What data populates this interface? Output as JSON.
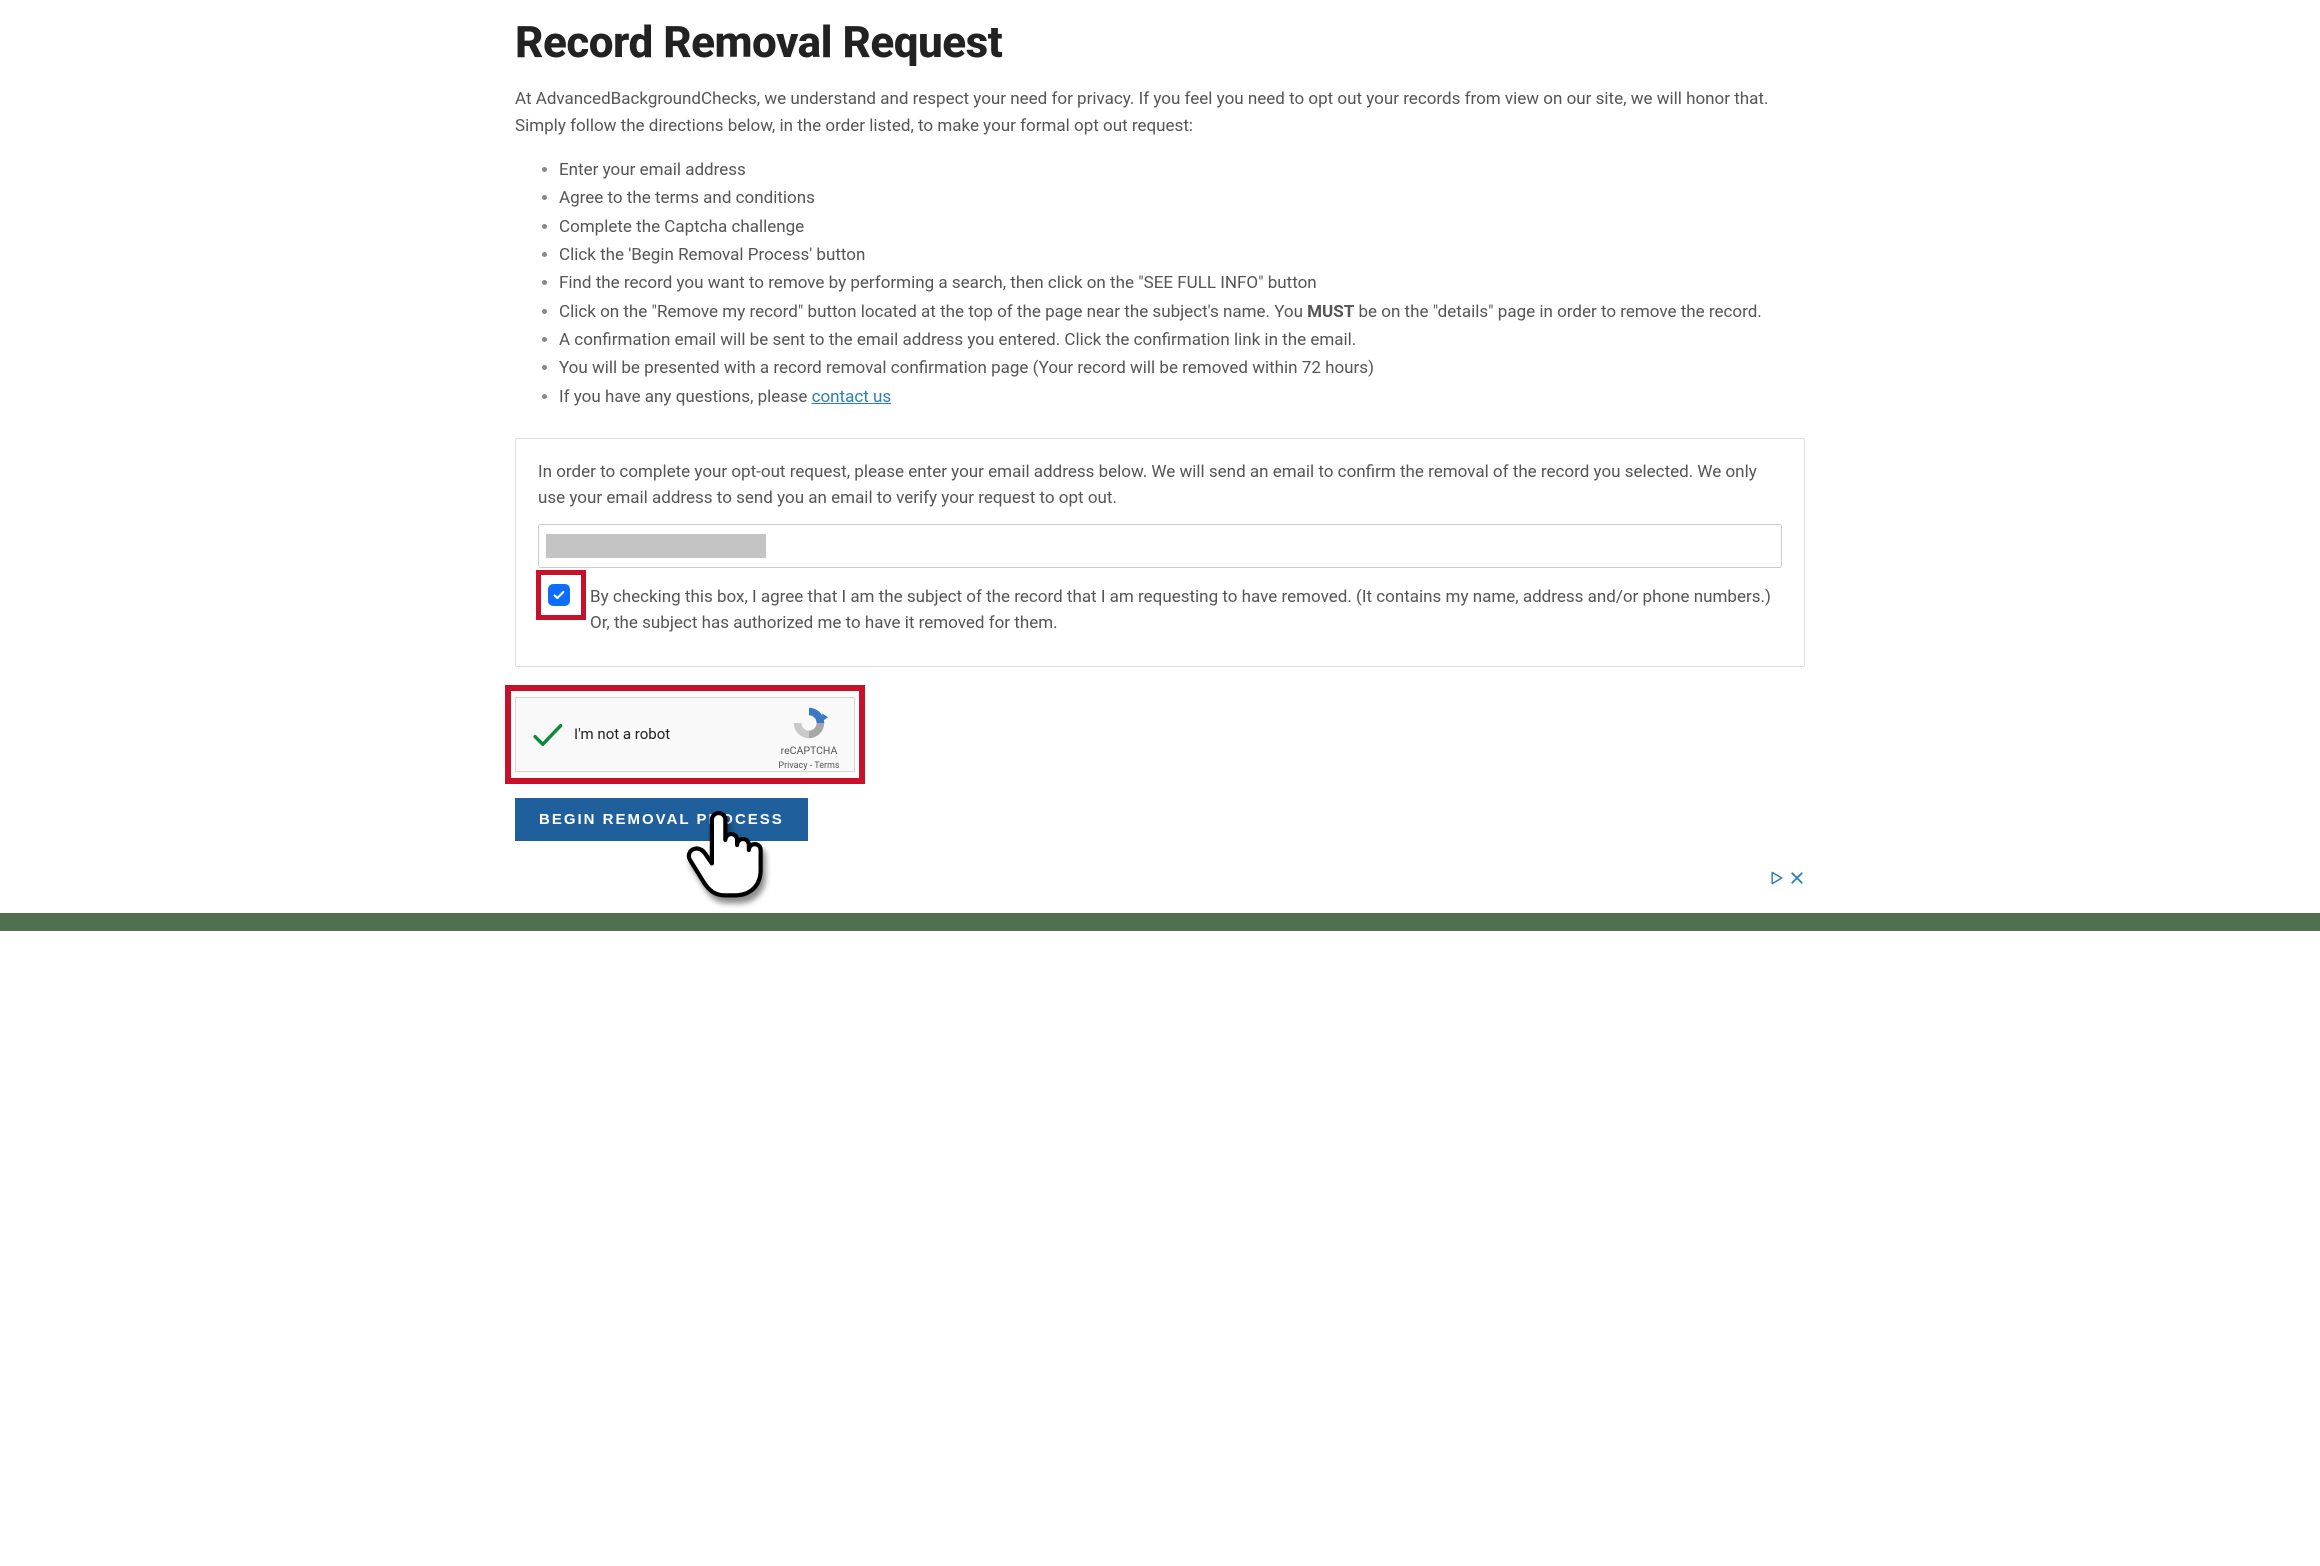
{
  "heading": "Record Removal Request",
  "intro": "At AdvancedBackgroundChecks, we understand and respect your need for privacy. If you feel you need to opt out your records from view on our site, we will honor that. Simply follow the directions below, in the order listed, to make your formal opt out request:",
  "steps": {
    "s1": "Enter your email address",
    "s2": "Agree to the terms and conditions",
    "s3": "Complete the Captcha challenge",
    "s4": "Click the 'Begin Removal Process' button",
    "s5": "Find the record you want to remove by performing a search, then click on the \"SEE FULL INFO\" button",
    "s6a": "Click on the \"Remove my record\" button located at the top of the page near the subject's name. You ",
    "s6b": "MUST",
    "s6c": " be on the \"details\" page in order to remove the record.",
    "s7": "A confirmation email will be sent to the email address you entered. Click the confirmation link in the email.",
    "s8": "You will be presented with a record removal confirmation page (Your record will be removed within 72 hours)",
    "s9a": "If you have any questions, please ",
    "s9link": "contact us"
  },
  "form": {
    "intro": "In order to complete your opt-out request, please enter your email address below. We will send an email to confirm the removal of the record you selected. We only use your email address to send you an email to verify your request to opt out.",
    "email_value": "",
    "consent": "By checking this box, I agree that I am the subject of the record that I am requesting to have removed. (It contains my name, address and/or phone numbers.) Or, the subject has authorized me to have it removed for them."
  },
  "captcha": {
    "label": "I'm not a robot",
    "brand": "reCAPTCHA",
    "privacy": "Privacy",
    "dash": " - ",
    "terms": "Terms"
  },
  "begin_button": "BEGIN REMOVAL PROCESS"
}
